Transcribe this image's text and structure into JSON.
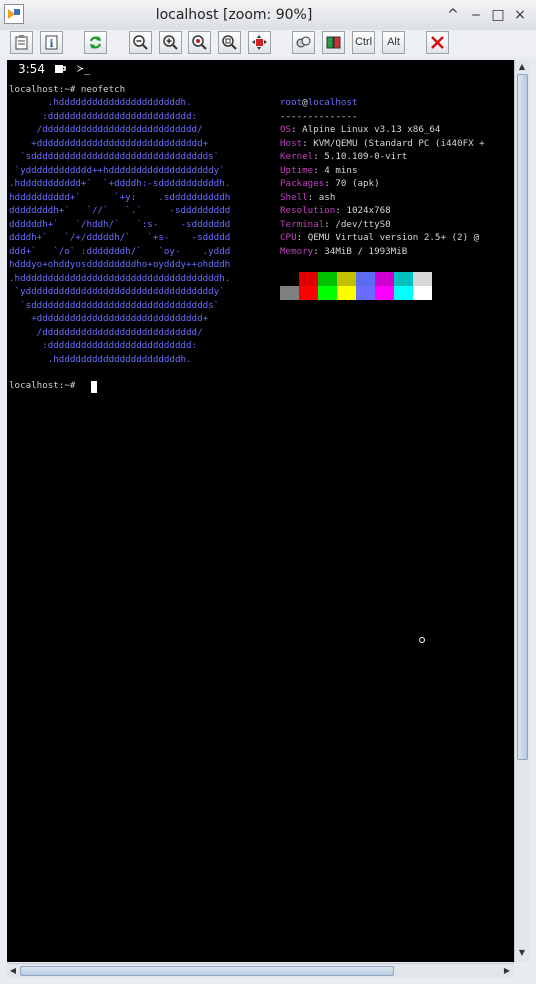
{
  "window": {
    "title": "localhost [zoom: 90%]",
    "controls": [
      "^",
      "‒",
      "□",
      "×"
    ]
  },
  "toolbar": {
    "buttons": [
      {
        "icon": "clipboard-icon"
      },
      {
        "icon": "info-icon"
      },
      {
        "icon": "refresh-icon"
      },
      {
        "icon": "zoom-out-icon"
      },
      {
        "icon": "zoom-in-icon"
      },
      {
        "icon": "zoom-100-icon"
      },
      {
        "icon": "zoom-fit-icon"
      },
      {
        "icon": "fullscreen-icon"
      },
      {
        "icon": "options-icon"
      },
      {
        "icon": "transfer-icon"
      },
      {
        "ctrl_label": "Ctrl"
      },
      {
        "alt_label": "Alt"
      },
      {
        "icon": "disconnect-icon"
      }
    ],
    "ctrl_label": "Ctrl",
    "alt_label": "Alt"
  },
  "terminal": {
    "clock": "3:54",
    "tray_icon_2": "≻_",
    "command_line": "localhost:~# neofetch",
    "ascii_art": "       .hddddddddddddddddddddddh.\n      :dddddddddddddddddddddddddd:\n     /dddddddddddddddddddddddddddd/\n    +dddddddddddddddddddddddddddddd+\n  `sdddddddddddddddddddddddddddddddds`\n `ydddddddddddd++hdddddddddddddddddddy`\n.hddddddddddd+`  `+ddddh:-sdddddddddddh.\nhdddddddddd+`      `+y:    .sddddddddddh\nddddddddh+`   `//`   `.`     -sddddddddd\nddddddh+`   `/hddh/`   `:s-    -sddddddd\nddddh+`   `/+/dddddh/`   `+s-    -sddddd\nddd+`   `/o` :dddddddh/`   `oy-    .yddd\nhdddyo+ohddyosdddddddddho+oydddy++ohdddh\n.hddddddddddddddddddddddddddddddddddddh.\n `yddddddddddddddddddddddddddddddddddy`\n  `sdddddddddddddddddddddddddddddddds`\n    +dddddddddddddddddddddddddddddd+\n     /dddddddddddddddddddddddddddd/\n      :dddddddddddddddddddddddddd:\n       .hddddddddddddddddddddddh.",
    "user": "root",
    "at": "@",
    "host": "localhost",
    "separator": "--------------",
    "info": [
      {
        "key": "OS",
        "value": "Alpine Linux v3.13 x86_64"
      },
      {
        "key": "Host",
        "value": "KVM/QEMU (Standard PC (i440FX +"
      },
      {
        "key": "Kernel",
        "value": "5.10.109-0-virt"
      },
      {
        "key": "Uptime",
        "value": "4 mins"
      },
      {
        "key": "Packages",
        "value": "70 (apk)"
      },
      {
        "key": "Shell",
        "value": "ash"
      },
      {
        "key": "Resolution",
        "value": "1024x768"
      },
      {
        "key": "Terminal",
        "value": "/dev/ttyS0"
      },
      {
        "key": "CPU",
        "value": "QEMU Virtual version 2.5+ (2) @"
      },
      {
        "key": "Memory",
        "value": "34MiB / 1993MiB"
      }
    ],
    "prompt": "localhost:~# ",
    "colors_dark": [
      "#000000",
      "#e00000",
      "#00c000",
      "#c0c000",
      "#5a6cf0",
      "#d000d0",
      "#00c0c0",
      "#d8d8d8"
    ],
    "colors_bright": [
      "#808080",
      "#ff0000",
      "#00ff00",
      "#ffff00",
      "#6b6bff",
      "#ff00ff",
      "#00ffff",
      "#ffffff"
    ]
  }
}
